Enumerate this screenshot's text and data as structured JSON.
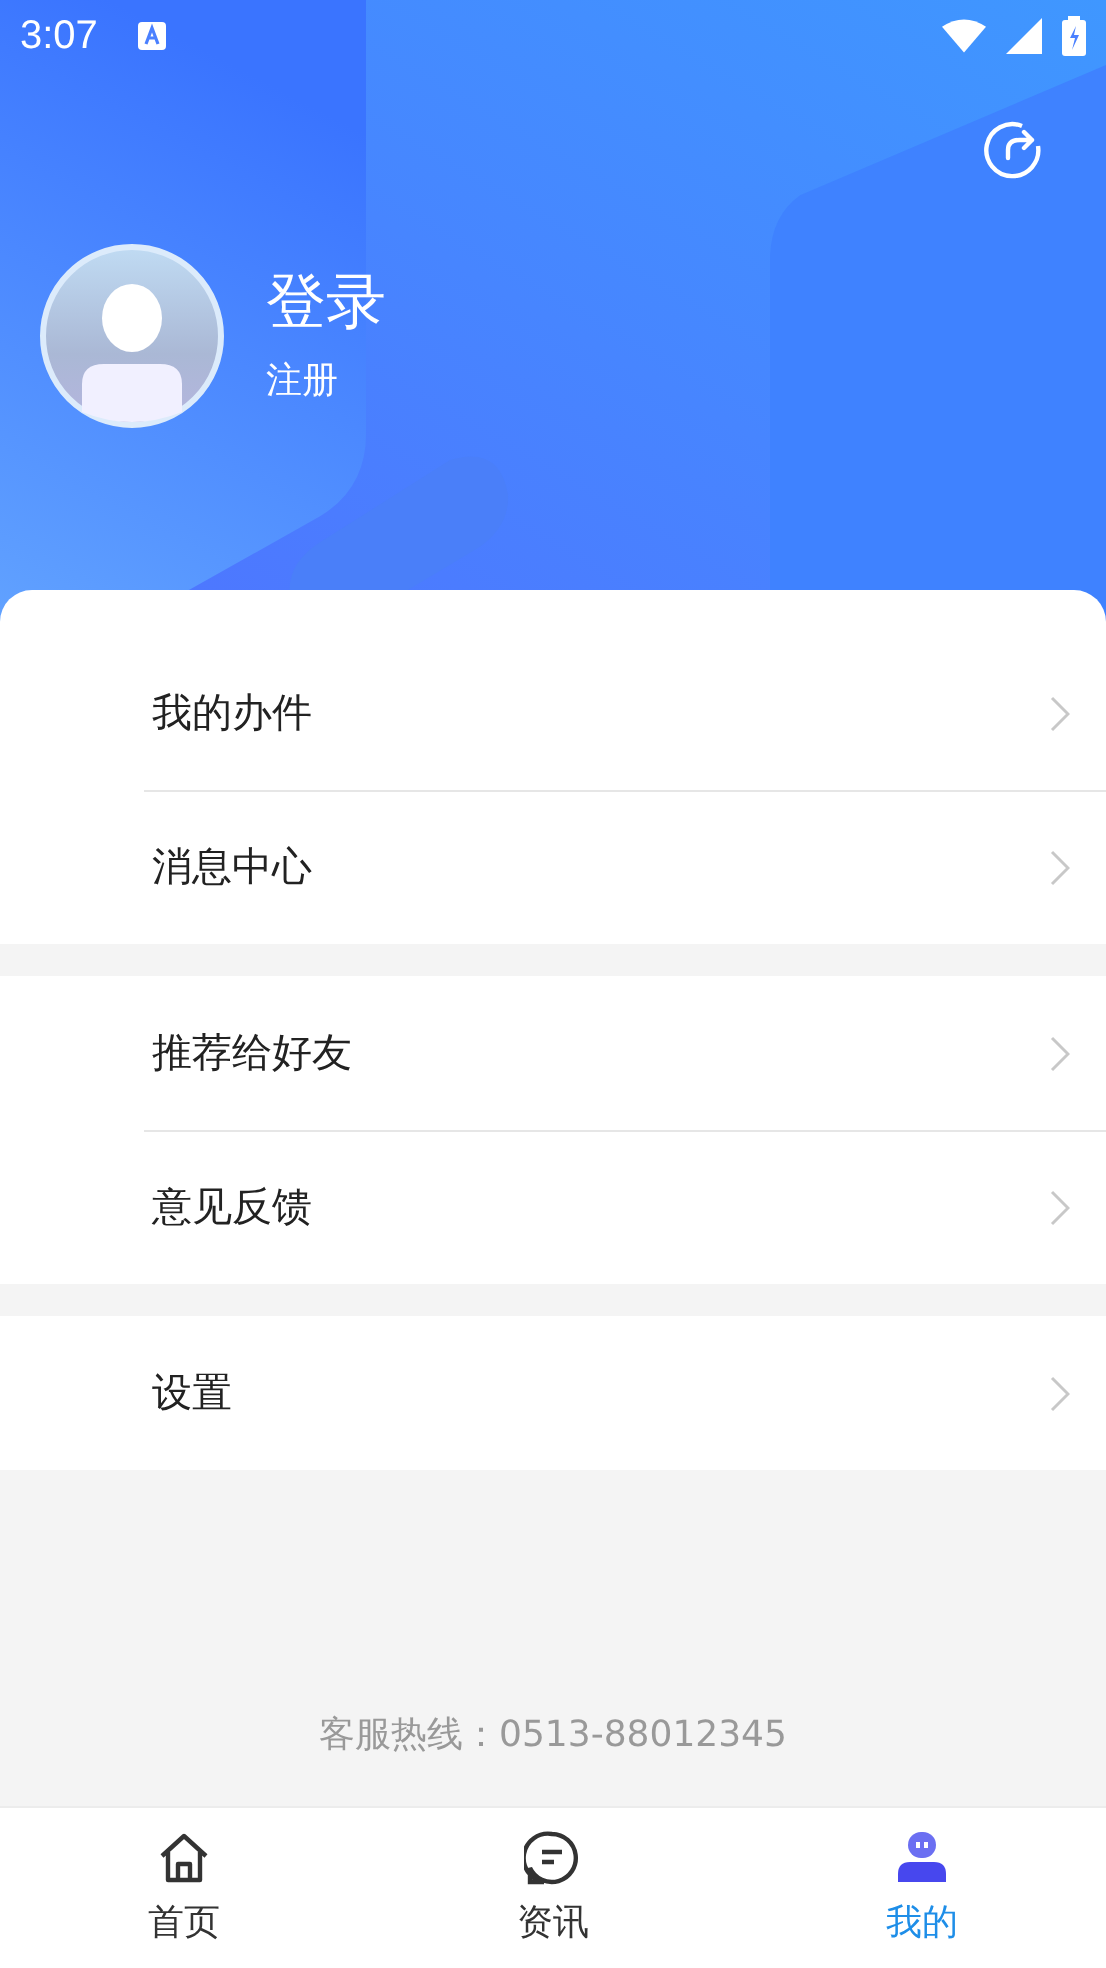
{
  "status_bar": {
    "time": "3:07"
  },
  "header": {
    "title": "登录",
    "subtitle": "注册"
  },
  "menu_groups": [
    {
      "items": [
        {
          "label": "我的办件"
        },
        {
          "label": "消息中心"
        }
      ]
    },
    {
      "items": [
        {
          "label": "推荐给好友"
        },
        {
          "label": "意见反馈"
        }
      ]
    },
    {
      "items": [
        {
          "label": "设置"
        }
      ]
    }
  ],
  "hotline": "客服热线：0513-88012345",
  "tabs": [
    {
      "label": "首页",
      "selected": false
    },
    {
      "label": "资讯",
      "selected": false
    },
    {
      "label": "我的",
      "selected": true
    }
  ]
}
